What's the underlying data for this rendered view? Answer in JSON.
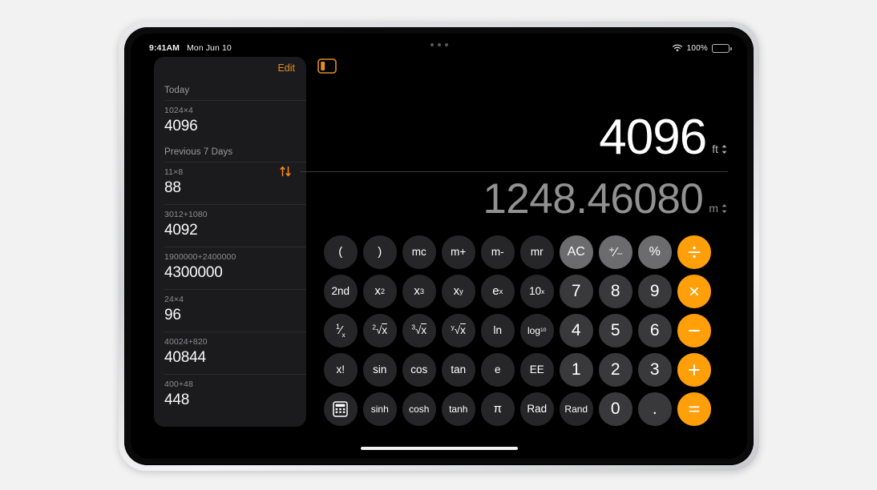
{
  "status_bar": {
    "time": "9:41AM",
    "date": "Mon Jun 10",
    "wifi_icon": "wifi-icon",
    "battery_percent": "100%",
    "battery_icon": "battery-full-icon",
    "multitask_dots": "multitasking-dots-icon"
  },
  "sidebar": {
    "edit_label": "Edit",
    "toggle_icon": "sidebar-toggle-icon",
    "sections": [
      {
        "title": "Today",
        "items": [
          {
            "expression": "1024×4",
            "result": "4096"
          }
        ]
      },
      {
        "title": "Previous 7 Days",
        "items": [
          {
            "expression": "11×8",
            "result": "88"
          },
          {
            "expression": "3012+1080",
            "result": "4092"
          },
          {
            "expression": "1900000+2400000",
            "result": "4300000"
          },
          {
            "expression": "24×4",
            "result": "96"
          },
          {
            "expression": "40024+820",
            "result": "40844"
          },
          {
            "expression": "400+48",
            "result": "448"
          }
        ]
      }
    ]
  },
  "display": {
    "input_value": "4096",
    "input_unit": "ft",
    "output_value": "1248.46080",
    "output_unit": "m",
    "swap_icon": "swap-vertical-icon",
    "unit_chevron_icon": "chevron-up-down-icon"
  },
  "keypad": {
    "rows": [
      [
        {
          "label": "(",
          "name": "key-open-paren",
          "style": "dark"
        },
        {
          "label": ")",
          "name": "key-close-paren",
          "style": "dark"
        },
        {
          "label": "mc",
          "name": "key-memory-clear",
          "style": "dark small"
        },
        {
          "label": "m+",
          "name": "key-memory-add",
          "style": "dark small"
        },
        {
          "label": "m-",
          "name": "key-memory-subtract",
          "style": "dark small"
        },
        {
          "label": "mr",
          "name": "key-memory-recall",
          "style": "dark small"
        },
        {
          "label": "AC",
          "name": "key-all-clear",
          "style": "light"
        },
        {
          "label": "⁺⁄₋",
          "name": "key-sign-toggle",
          "style": "light"
        },
        {
          "label": "%",
          "name": "key-percent",
          "style": "light"
        },
        {
          "label": "÷",
          "name": "key-divide",
          "style": "accent"
        }
      ],
      [
        {
          "label": "2nd",
          "name": "key-second-function",
          "style": "dark small"
        },
        {
          "label": "x²",
          "name": "key-x-squared",
          "style": "dark"
        },
        {
          "label": "x³",
          "name": "key-x-cubed",
          "style": "dark"
        },
        {
          "label": "xʸ",
          "name": "key-x-to-y",
          "style": "dark"
        },
        {
          "label": "eˣ",
          "name": "key-e-to-x",
          "style": "dark"
        },
        {
          "label": "10ˣ",
          "name": "key-ten-to-x",
          "style": "dark small"
        },
        {
          "label": "7",
          "name": "key-7",
          "style": "num"
        },
        {
          "label": "8",
          "name": "key-8",
          "style": "num"
        },
        {
          "label": "9",
          "name": "key-9",
          "style": "num"
        },
        {
          "label": "×",
          "name": "key-multiply",
          "style": "accent"
        }
      ],
      [
        {
          "label": "¹⁄ₓ",
          "name": "key-reciprocal",
          "style": "dark"
        },
        {
          "label": "²√x",
          "name": "key-square-root",
          "style": "dark small"
        },
        {
          "label": "³√x",
          "name": "key-cube-root",
          "style": "dark small"
        },
        {
          "label": "ʸ√x",
          "name": "key-nth-root",
          "style": "dark small"
        },
        {
          "label": "ln",
          "name": "key-natural-log",
          "style": "dark small"
        },
        {
          "label": "log₁₀",
          "name": "key-log-base-10",
          "style": "dark tiny"
        },
        {
          "label": "4",
          "name": "key-4",
          "style": "num"
        },
        {
          "label": "5",
          "name": "key-5",
          "style": "num"
        },
        {
          "label": "6",
          "name": "key-6",
          "style": "num"
        },
        {
          "label": "−",
          "name": "key-subtract",
          "style": "accent"
        }
      ],
      [
        {
          "label": "x!",
          "name": "key-factorial",
          "style": "dark small"
        },
        {
          "label": "sin",
          "name": "key-sine",
          "style": "dark small"
        },
        {
          "label": "cos",
          "name": "key-cosine",
          "style": "dark small"
        },
        {
          "label": "tan",
          "name": "key-tangent",
          "style": "dark small"
        },
        {
          "label": "e",
          "name": "key-euler-number",
          "style": "dark small"
        },
        {
          "label": "EE",
          "name": "key-exponent-entry",
          "style": "dark small"
        },
        {
          "label": "1",
          "name": "key-1",
          "style": "num"
        },
        {
          "label": "2",
          "name": "key-2",
          "style": "num"
        },
        {
          "label": "3",
          "name": "key-3",
          "style": "num"
        },
        {
          "label": "+",
          "name": "key-add",
          "style": "accent"
        }
      ],
      [
        {
          "label": "⌨",
          "name": "key-calculator-mode",
          "style": "dark"
        },
        {
          "label": "sinh",
          "name": "key-hyperbolic-sine",
          "style": "dark tiny"
        },
        {
          "label": "cosh",
          "name": "key-hyperbolic-cosine",
          "style": "dark tiny"
        },
        {
          "label": "tanh",
          "name": "key-hyperbolic-tangent",
          "style": "dark tiny"
        },
        {
          "label": "π",
          "name": "key-pi",
          "style": "dark"
        },
        {
          "label": "Rad",
          "name": "key-radians",
          "style": "dark small"
        },
        {
          "label": "Rand",
          "name": "key-random",
          "style": "dark tiny"
        },
        {
          "label": "0",
          "name": "key-0",
          "style": "num"
        },
        {
          "label": ".",
          "name": "key-decimal-point",
          "style": "num"
        },
        {
          "label": "=",
          "name": "key-equals",
          "style": "accent"
        }
      ]
    ]
  },
  "colors": {
    "accent": "#ff9f0a",
    "edit_orange": "#e08c28",
    "screen_bg": "#000000",
    "sidebar_bg": "#1b1b1d"
  }
}
